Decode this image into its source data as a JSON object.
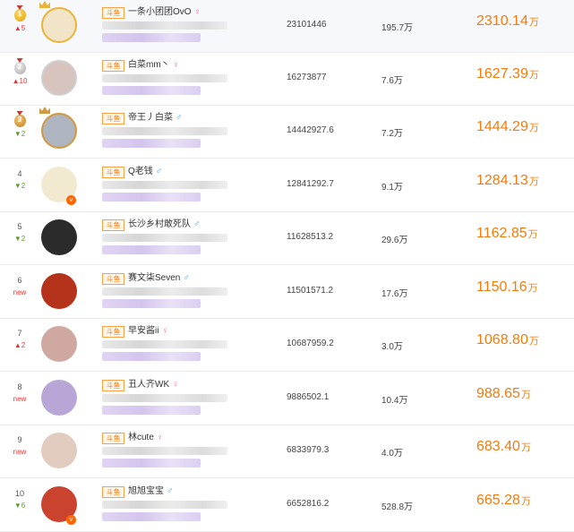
{
  "rows": [
    {
      "rank": "1",
      "medal": "gold",
      "trend": "▲5",
      "trend_type": "up",
      "avatar_color": "#f2e4c6",
      "crown": "gold",
      "tag": "斗鱼",
      "name": "一条小团团OvO",
      "gender": "f",
      "gender_icon": "♀",
      "number": "23101446",
      "wan": "195.7万",
      "amount": "2310.14",
      "unit": "万"
    },
    {
      "rank": "2",
      "medal": "silver",
      "trend": "▲10",
      "trend_type": "up",
      "avatar_color": "#d7c4bf",
      "crown": "",
      "tag": "斗鱼",
      "name": "白菜mm丶",
      "gender": "f",
      "gender_icon": "♀",
      "number": "16273877",
      "wan": "7.6万",
      "amount": "1627.39",
      "unit": "万"
    },
    {
      "rank": "3",
      "medal": "bronze",
      "trend": "▼2",
      "trend_type": "down",
      "avatar_color": "#aeb4c0",
      "crown": "bronze",
      "tag": "斗鱼",
      "name": "帝王丿白菜",
      "gender": "m",
      "gender_icon": "♂",
      "number": "14442927.6",
      "wan": "7.2万",
      "amount": "1444.29",
      "unit": "万"
    },
    {
      "rank": "4",
      "medal": "",
      "trend": "▼2",
      "trend_type": "down",
      "avatar_color": "#f1ead0",
      "crown": "",
      "tag": "斗鱼",
      "name": "Q老钱",
      "gender": "m",
      "gender_icon": "♂",
      "number": "12841292.7",
      "wan": "9.1万",
      "amount": "1284.13",
      "unit": "万"
    },
    {
      "rank": "5",
      "medal": "",
      "trend": "▼2",
      "trend_type": "down",
      "avatar_color": "#2b2b2b",
      "crown": "",
      "tag": "斗鱼",
      "name": "长沙乡村敢死队",
      "gender": "m",
      "gender_icon": "♂",
      "number": "11628513.2",
      "wan": "29.6万",
      "amount": "1162.85",
      "unit": "万"
    },
    {
      "rank": "6",
      "medal": "",
      "trend": "new",
      "trend_type": "new",
      "avatar_color": "#b5321b",
      "crown": "",
      "tag": "斗鱼",
      "name": "赛文柒Seven",
      "gender": "m",
      "gender_icon": "♂",
      "number": "11501571.2",
      "wan": "17.6万",
      "amount": "1150.16",
      "unit": "万"
    },
    {
      "rank": "7",
      "medal": "",
      "trend": "▲2",
      "trend_type": "up",
      "avatar_color": "#cfa9a1",
      "crown": "",
      "tag": "斗鱼",
      "name": "早安酱ii",
      "gender": "f",
      "gender_icon": "♀",
      "number": "10687959.2",
      "wan": "3.0万",
      "amount": "1068.80",
      "unit": "万"
    },
    {
      "rank": "8",
      "medal": "",
      "trend": "new",
      "trend_type": "new",
      "avatar_color": "#b8a7d6",
      "crown": "",
      "tag": "斗鱼",
      "name": "丑人齐WK",
      "gender": "f",
      "gender_icon": "♀",
      "number": "9886502.1",
      "wan": "10.4万",
      "amount": "988.65",
      "unit": "万"
    },
    {
      "rank": "9",
      "medal": "",
      "trend": "new",
      "trend_type": "new",
      "avatar_color": "#e2cbbf",
      "crown": "",
      "tag": "斗鱼",
      "name": "林cute",
      "gender": "f",
      "gender_icon": "♀",
      "number": "6833979.3",
      "wan": "4.0万",
      "amount": "683.40",
      "unit": "万"
    },
    {
      "rank": "10",
      "medal": "",
      "trend": "▼6",
      "trend_type": "down",
      "avatar_color": "#c9432e",
      "crown": "",
      "tag": "斗鱼",
      "name": "旭旭宝宝",
      "gender": "m",
      "gender_icon": "♂",
      "number": "6652816.2",
      "wan": "528.8万",
      "amount": "665.28",
      "unit": "万"
    }
  ]
}
